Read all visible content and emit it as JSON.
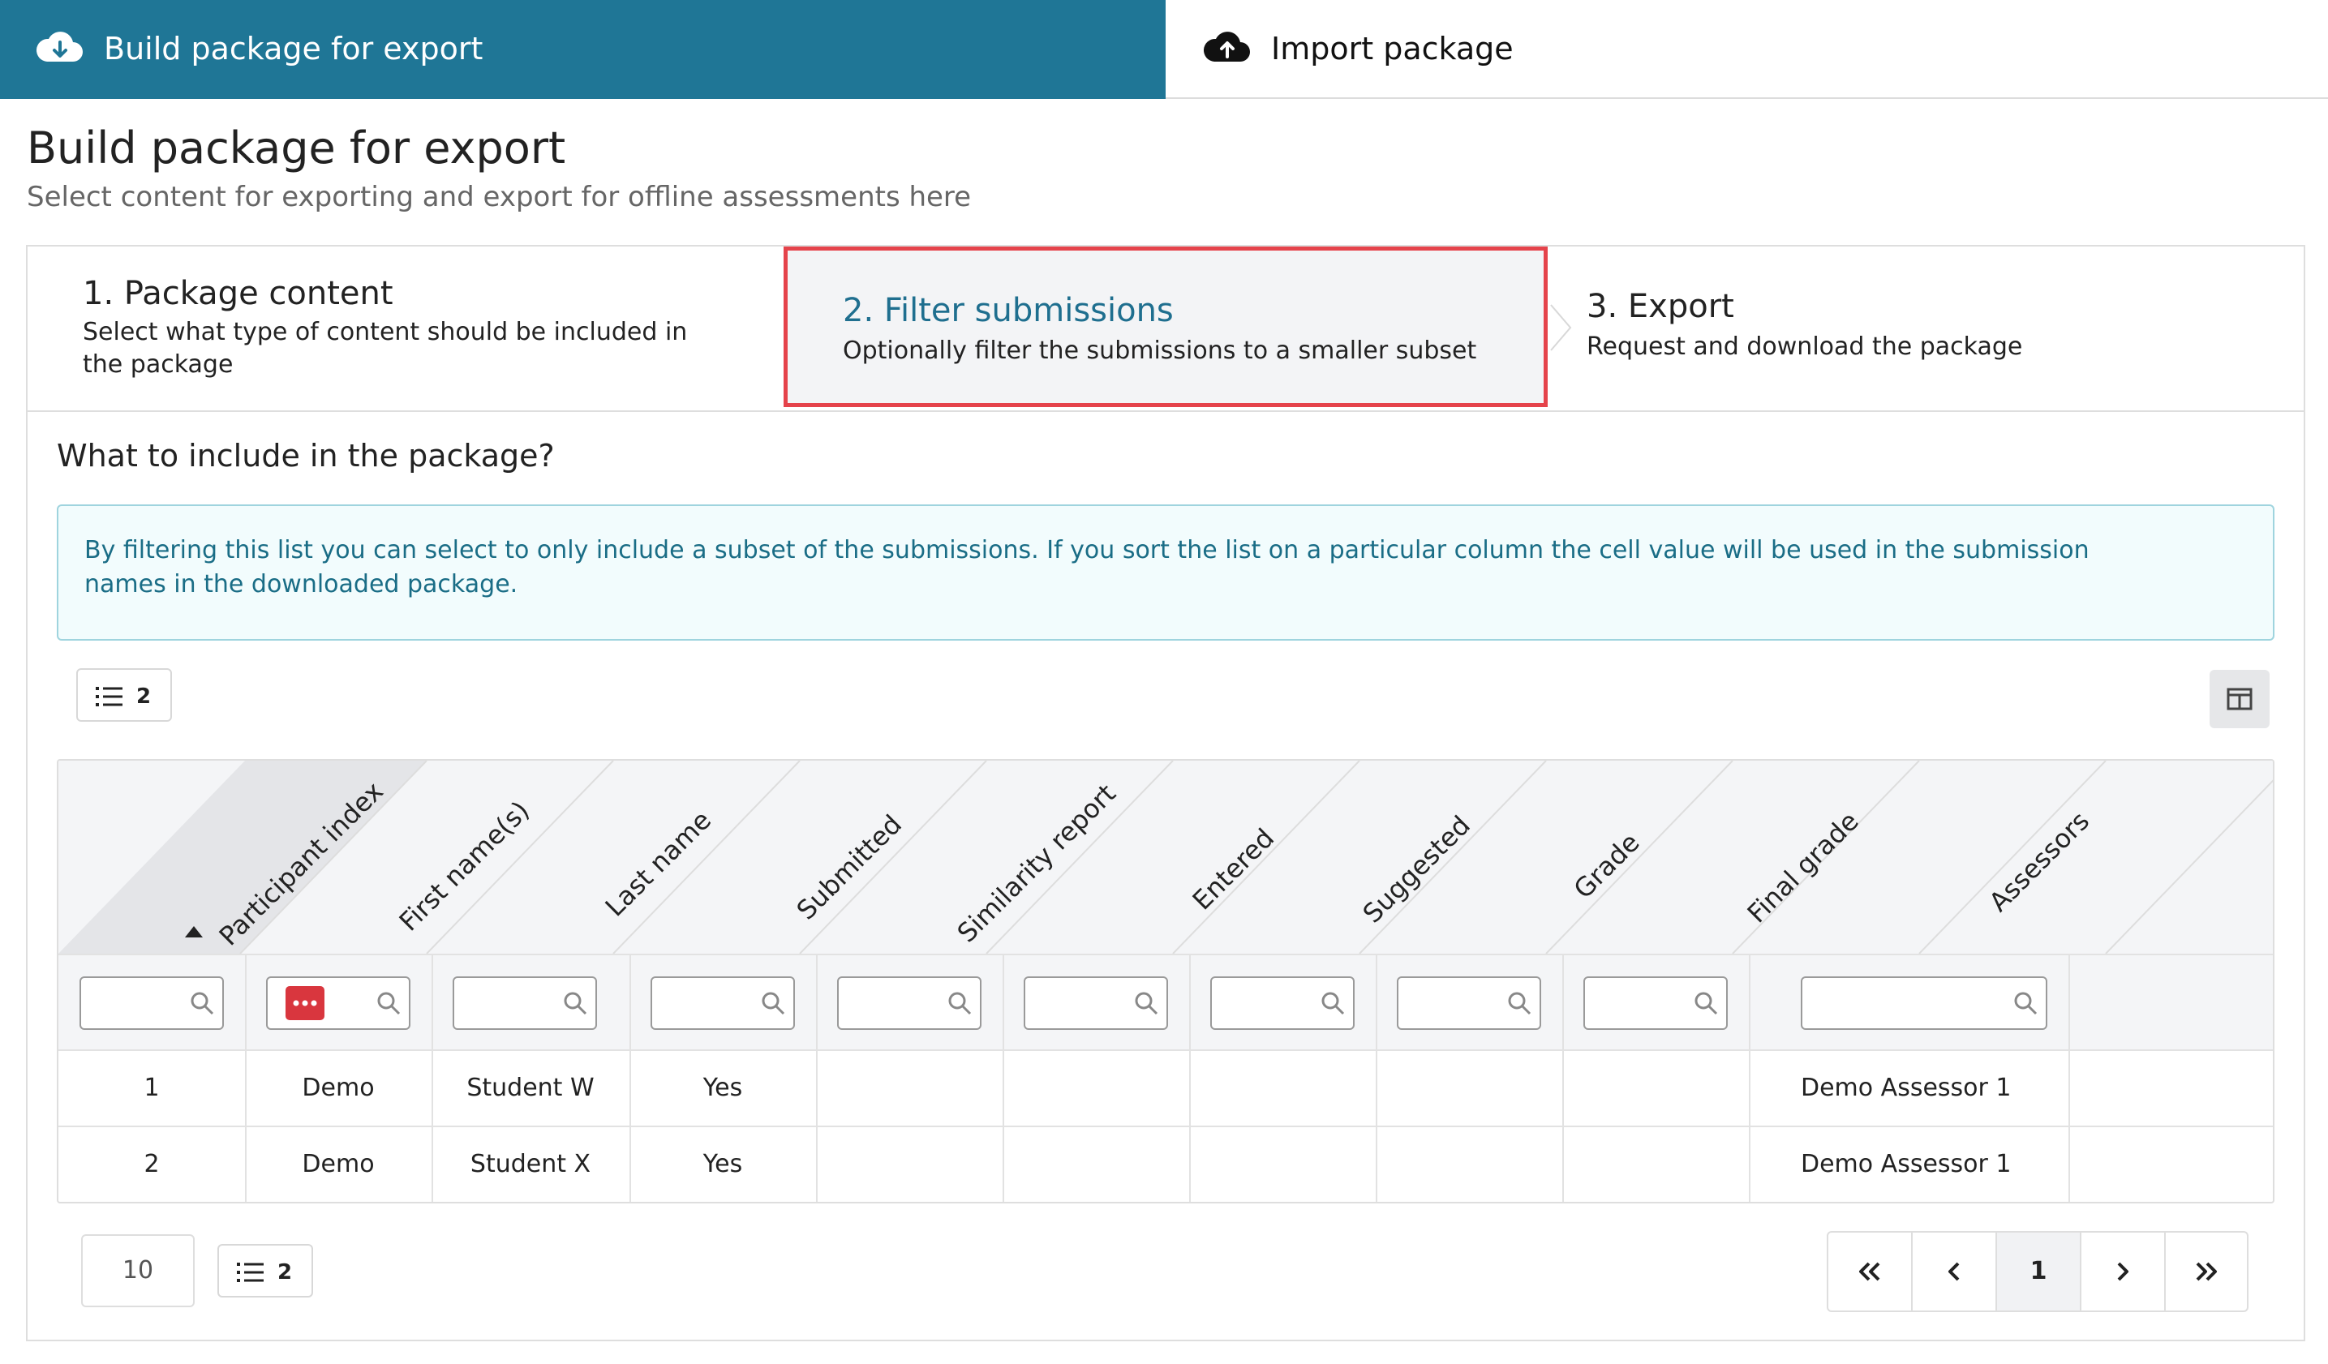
{
  "tabs": {
    "export": {
      "label": "Build package for export",
      "icon": "cloud-download-icon"
    },
    "import": {
      "label": "Import package",
      "icon": "cloud-upload-icon"
    }
  },
  "page": {
    "title": "Build package for export",
    "subtitle": "Select content for exporting and export for offline assessments here"
  },
  "steps": [
    {
      "title": "1. Package content",
      "description": "Select what type of content should be included in the package"
    },
    {
      "title": "2. Filter submissions",
      "description": "Optionally filter the submissions to a smaller subset"
    },
    {
      "title": "3. Export",
      "description": "Request and download the package"
    }
  ],
  "section": {
    "title": "What to include in the package?",
    "info": "By filtering this list you can select to only include a subset of the submissions. If you sort the list on a particular column the cell value will be used in the submission names in the downloaded package."
  },
  "list_count_top": "2",
  "table": {
    "columns": [
      "Participant index",
      "First name(s)",
      "Last name",
      "Submitted",
      "Similarity report",
      "Entered",
      "Suggested",
      "Grade",
      "Final grade",
      "Assessors"
    ],
    "sorted_column": "Participant index",
    "sort_direction": "ascending",
    "rows": [
      [
        "1",
        "Demo",
        "Student W",
        "Yes",
        "",
        "",
        "",
        "",
        "",
        "Demo Assessor 1"
      ],
      [
        "2",
        "Demo",
        "Student X",
        "Yes",
        "",
        "",
        "",
        "",
        "",
        "Demo Assessor 1"
      ]
    ]
  },
  "footer": {
    "page_size": "10",
    "list_count_bottom": "2",
    "current_page": "1"
  },
  "colors": {
    "accent": "#1f7696",
    "highlight_border": "#e5434b",
    "info_text": "#1a6d86",
    "filter_menu": "#d9363e"
  }
}
